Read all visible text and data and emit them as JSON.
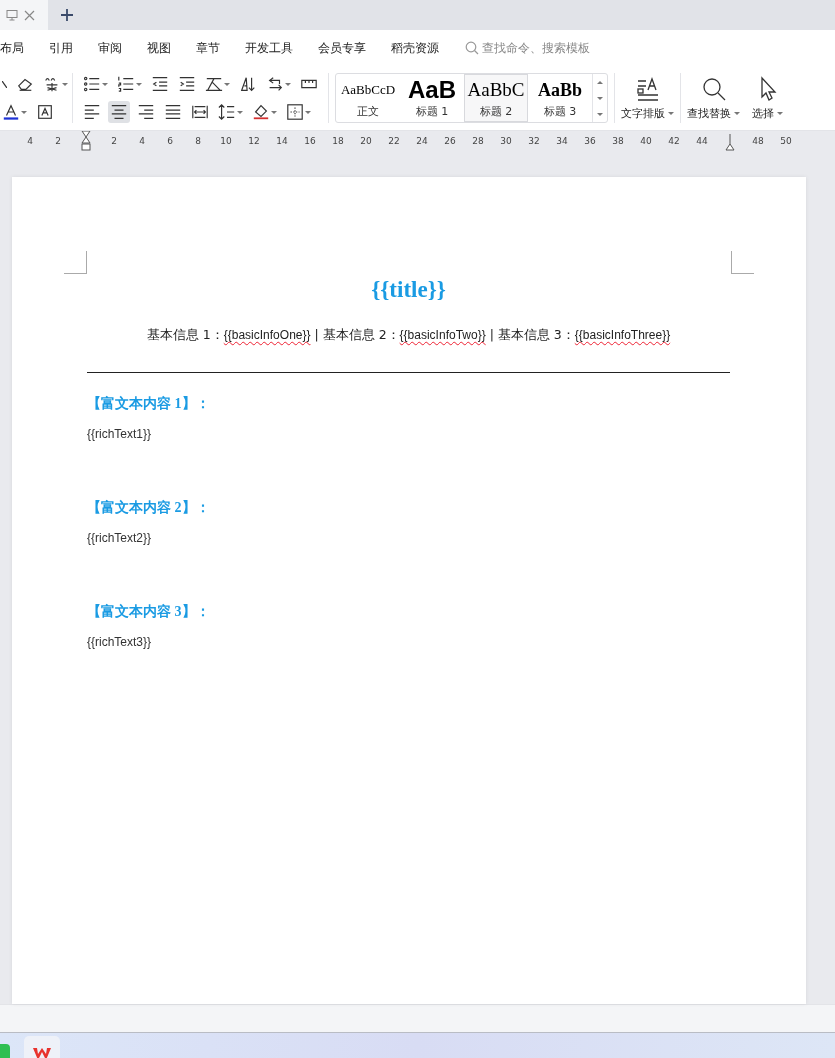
{
  "tab_bar": {
    "tabs": [
      {
        "kind": "document",
        "selected": true
      }
    ]
  },
  "menu": {
    "items": [
      "布局",
      "引用",
      "审阅",
      "视图",
      "章节",
      "开发工具",
      "会员专享",
      "稻壳资源"
    ],
    "search": {
      "placeholder": "查找命令、搜索模板"
    }
  },
  "toolbar": {
    "groups": [
      {
        "rows": [
          [
            {
              "kind": "cut-partial",
              "dropdown": false,
              "selected": false
            },
            {
              "kind": "eraser",
              "dropdown": false,
              "selected": false
            },
            {
              "kind": "pinyin",
              "dropdown": true,
              "selected": false
            }
          ],
          [
            {
              "kind": "font-color",
              "dropdown": true,
              "selected": false
            },
            {
              "kind": "char-border",
              "dropdown": false,
              "selected": false
            }
          ]
        ]
      },
      {
        "rows": [
          [
            {
              "kind": "bullets",
              "dropdown": true,
              "selected": false
            },
            {
              "kind": "numbering",
              "dropdown": true,
              "selected": false
            },
            {
              "kind": "outdent",
              "dropdown": false,
              "selected": false
            },
            {
              "kind": "indent",
              "dropdown": false,
              "selected": false
            },
            {
              "kind": "chinese-layout",
              "dropdown": true,
              "selected": false
            },
            {
              "kind": "sort",
              "dropdown": false,
              "selected": false
            },
            {
              "kind": "line-break",
              "dropdown": true,
              "selected": false
            },
            {
              "kind": "grid",
              "dropdown": false,
              "selected": false
            }
          ],
          [
            {
              "kind": "align-left",
              "dropdown": false,
              "selected": false
            },
            {
              "kind": "align-center",
              "dropdown": false,
              "selected": true
            },
            {
              "kind": "align-right",
              "dropdown": false,
              "selected": false
            },
            {
              "kind": "justify",
              "dropdown": false,
              "selected": false
            },
            {
              "kind": "distribute",
              "dropdown": false,
              "selected": false
            },
            {
              "kind": "line-spacing",
              "dropdown": true,
              "selected": false
            },
            {
              "kind": "shading",
              "dropdown": true,
              "selected": false
            },
            {
              "kind": "borders",
              "dropdown": true,
              "selected": false
            }
          ]
        ]
      }
    ],
    "styles": [
      {
        "sample": "AaBbCcD",
        "label": "正文",
        "kind": "body",
        "selected": false
      },
      {
        "sample": "AaB",
        "label": "标题 1",
        "kind": "heading1",
        "selected": false
      },
      {
        "sample": "AaBbC",
        "label": "标题 2",
        "kind": "heading2",
        "selected": true
      },
      {
        "sample": "AaBb",
        "label": "标题 3",
        "kind": "heading3",
        "selected": false
      }
    ],
    "big_buttons": [
      {
        "kind": "text-layout",
        "label": "文字排版",
        "dropdown": true
      },
      {
        "kind": "find",
        "label": "查找替换",
        "dropdown": true
      },
      {
        "kind": "select",
        "label": "选择",
        "dropdown": true
      }
    ]
  },
  "ruler": {
    "marks": [
      {
        "kind": "number",
        "text": "4"
      },
      {
        "kind": "number",
        "text": "2"
      },
      {
        "kind": "left-indent"
      },
      {
        "kind": "number",
        "text": "2"
      },
      {
        "kind": "number",
        "text": "4"
      },
      {
        "kind": "number",
        "text": "6"
      },
      {
        "kind": "number",
        "text": "8"
      },
      {
        "kind": "number",
        "text": "10"
      },
      {
        "kind": "number",
        "text": "12"
      },
      {
        "kind": "number",
        "text": "14"
      },
      {
        "kind": "number",
        "text": "16"
      },
      {
        "kind": "number",
        "text": "18"
      },
      {
        "kind": "number",
        "text": "20"
      },
      {
        "kind": "number",
        "text": "22"
      },
      {
        "kind": "number",
        "text": "24"
      },
      {
        "kind": "number",
        "text": "26"
      },
      {
        "kind": "number",
        "text": "28"
      },
      {
        "kind": "number",
        "text": "30"
      },
      {
        "kind": "number",
        "text": "32"
      },
      {
        "kind": "number",
        "text": "34"
      },
      {
        "kind": "number",
        "text": "36"
      },
      {
        "kind": "number",
        "text": "38"
      },
      {
        "kind": "number",
        "text": "40"
      },
      {
        "kind": "number",
        "text": "42"
      },
      {
        "kind": "number",
        "text": "44"
      },
      {
        "kind": "right-indent"
      },
      {
        "kind": "number",
        "text": "48"
      },
      {
        "kind": "number",
        "text": "50"
      }
    ]
  },
  "document": {
    "title": "{{title}}",
    "info_line": [
      {
        "text": "基本信息 1：",
        "misspelled": false
      },
      {
        "text": "{{basicInfoOne}}",
        "misspelled": true
      },
      {
        "text": " | 基本信息 2：",
        "misspelled": false
      },
      {
        "text": "{{basicInfoTwo}}",
        "misspelled": true
      },
      {
        "text": " | 基本信息 3：",
        "misspelled": false
      },
      {
        "text": "{{basicInfoThree}}",
        "misspelled": true
      }
    ],
    "sections": [
      {
        "heading": "【富文本内容 1】：",
        "body": "{{richText1}}"
      },
      {
        "heading": "【富文本内容 2】：",
        "body": "{{richText2}}"
      },
      {
        "heading": "【富文本内容 3】：",
        "body": "{{richText3}}"
      }
    ]
  },
  "taskbar": {
    "apps": [
      {
        "kind": "green-app"
      },
      {
        "kind": "office-app"
      }
    ]
  }
}
